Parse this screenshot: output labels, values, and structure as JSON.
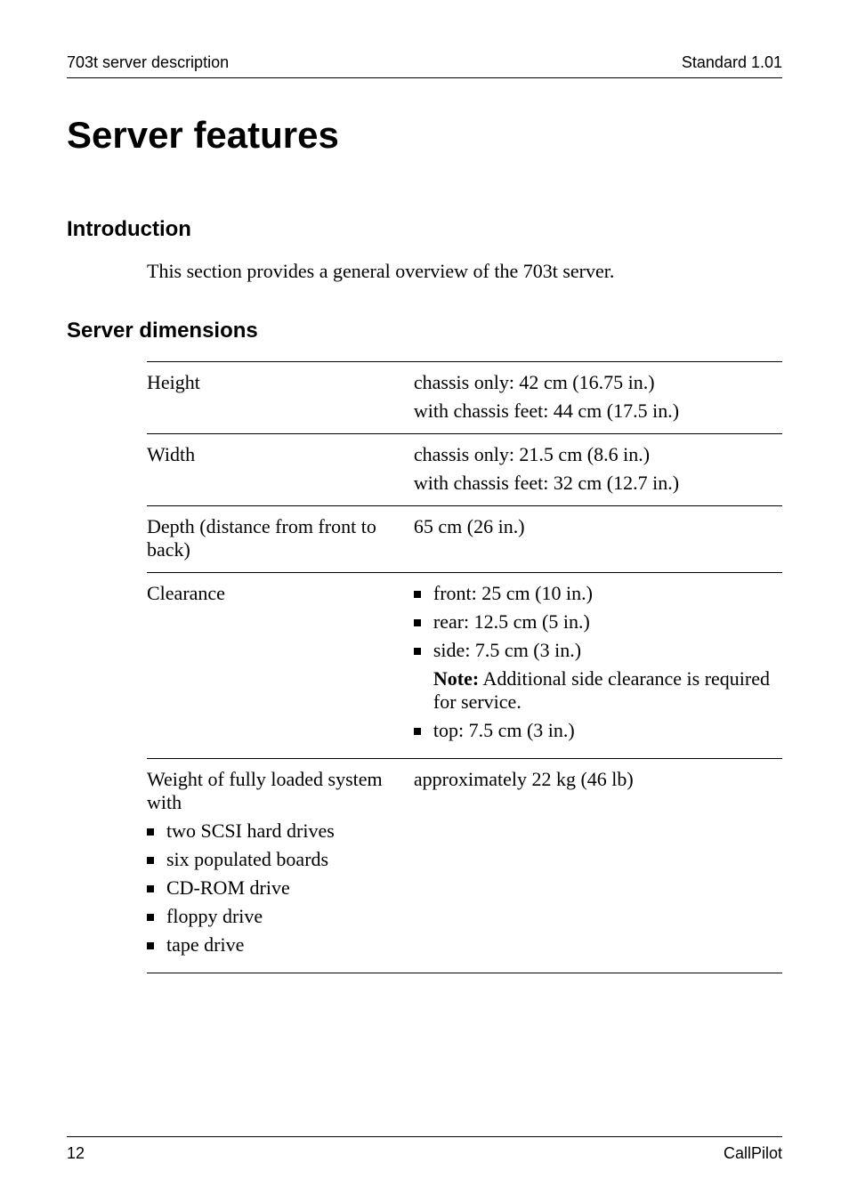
{
  "header": {
    "left": "703t server description",
    "right": "Standard 1.01"
  },
  "title": "Server features",
  "sections": {
    "intro": {
      "heading": "Introduction",
      "body": "This section provides a general overview of the 703t server."
    },
    "dimensions": {
      "heading": "Server dimensions",
      "rows": {
        "height": {
          "label": "Height",
          "line1": "chassis only: 42 cm (16.75 in.)",
          "line2": "with chassis feet: 44 cm (17.5 in.)"
        },
        "width": {
          "label": "Width",
          "line1": "chassis only: 21.5 cm (8.6 in.)",
          "line2": "with chassis feet: 32 cm (12.7 in.)"
        },
        "depth": {
          "label": "Depth (distance from front to back)",
          "value": "65 cm (26 in.)"
        },
        "clearance": {
          "label": "Clearance",
          "items": {
            "front": "front: 25 cm (10 in.)",
            "rear": "rear: 12.5 cm (5 in.)",
            "side": "side: 7.5 cm (3 in.)",
            "top": "top: 7.5 cm (3 in.)"
          },
          "note_bold": "Note:",
          "note_rest": " Additional side clearance is required for service."
        },
        "weight": {
          "label_intro": "Weight of fully loaded system with",
          "items": {
            "i1": "two SCSI hard drives",
            "i2": "six populated boards",
            "i3": "CD-ROM drive",
            "i4": "floppy drive",
            "i5": "tape drive"
          },
          "value": "approximately 22 kg (46 lb)"
        }
      }
    }
  },
  "footer": {
    "left": "12",
    "right": "CallPilot"
  }
}
